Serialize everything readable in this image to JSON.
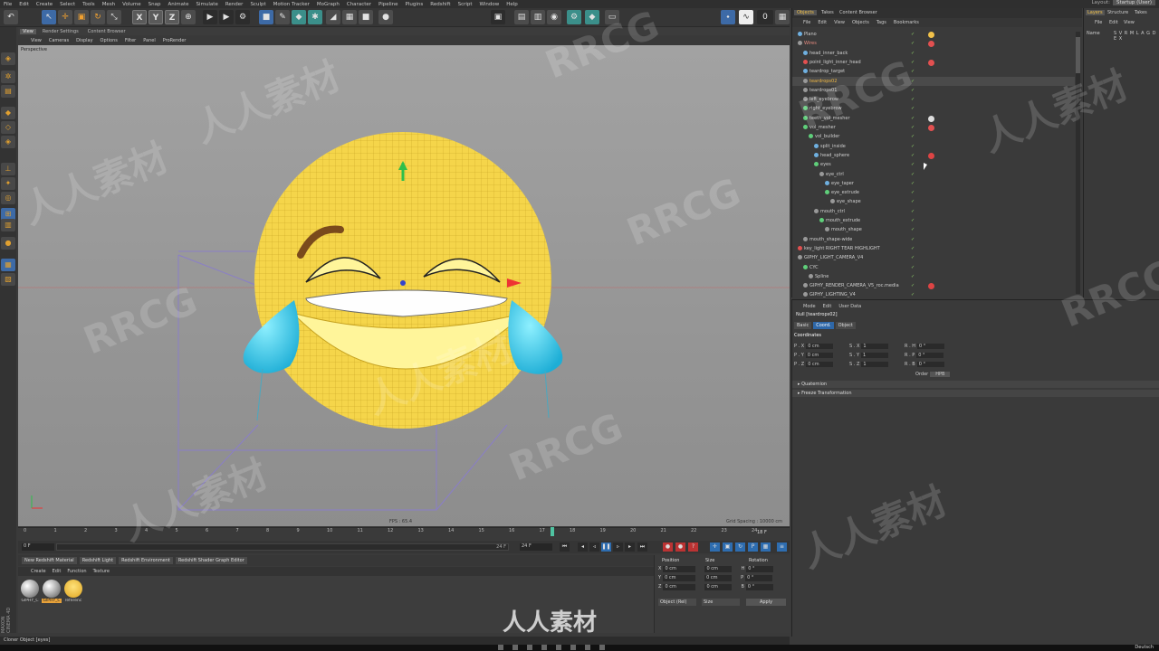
{
  "menubar": {
    "items": [
      "File",
      "Edit",
      "Create",
      "Select",
      "Tools",
      "Mesh",
      "Volume",
      "Snap",
      "Animate",
      "Simulate",
      "Render",
      "Sculpt",
      "Motion Tracker",
      "MoGraph",
      "Character",
      "Pipeline",
      "Plugins",
      "Redshift",
      "Script",
      "Window",
      "Help"
    ],
    "layout_label": "Layout:",
    "layout_value": "Startup (User)"
  },
  "toolbar": {
    "axis_x": "X",
    "axis_y": "Y",
    "axis_z": "Z",
    "frame_value": "0"
  },
  "viewport": {
    "tabs": [
      "View",
      "Render Settings",
      "Content Browser"
    ],
    "menu": [
      "View",
      "Cameras",
      "Display",
      "Options",
      "Filter",
      "Panel",
      "ProRender"
    ],
    "camera_label": "Perspective",
    "fps_text": "FPS : 65.4",
    "grid_spacing": "Grid Spacing : 10000 cm"
  },
  "timeline": {
    "ticks": [
      "0",
      "1",
      "2",
      "3",
      "4",
      "5",
      "6",
      "7",
      "8",
      "9",
      "10",
      "11",
      "12",
      "13",
      "14",
      "15",
      "16",
      "17",
      "18",
      "19",
      "20",
      "21",
      "22",
      "23",
      "24"
    ],
    "current_frame_label": "18 F",
    "start_frame": "0 F",
    "end_frame": "24 F",
    "range_end": "24 F"
  },
  "render_tabs": [
    "New Redshift Material",
    "Redshift Light",
    "Redshift Environment",
    "Redshift Shader Graph Editor"
  ],
  "material_menu": [
    "Create",
    "Edit",
    "Function",
    "Texture"
  ],
  "materials": [
    {
      "label": "GIPHY_C",
      "selected": false
    },
    {
      "label": "GIPHY_C",
      "selected": true
    },
    {
      "label": "referenc",
      "selected": false
    }
  ],
  "coord_manager": {
    "headers": [
      "Position",
      "Size",
      "Rotation"
    ],
    "rows": [
      {
        "axis": "X",
        "pos": "0 cm",
        "size": "0 cm",
        "rot_label": "H",
        "rot": "0 °"
      },
      {
        "axis": "Y",
        "pos": "0 cm",
        "size": "0 cm",
        "rot_label": "P",
        "rot": "0 °"
      },
      {
        "axis": "Z",
        "pos": "0 cm",
        "size": "0 cm",
        "rot_label": "B",
        "rot": "0 °"
      }
    ],
    "mode_dropdown": "Object (Rel)",
    "size_dropdown": "Size",
    "apply_label": "Apply"
  },
  "status": "Cloner Object [eyes]",
  "taskbar": {
    "time": "Deutsch"
  },
  "object_manager": {
    "tabs": [
      "Objects",
      "Takes",
      "Content Browser"
    ],
    "menu": [
      "File",
      "Edit",
      "View",
      "Objects",
      "Tags",
      "Bookmarks"
    ],
    "rows": [
      {
        "name": "Plano",
        "indent": 0,
        "icon": "b",
        "style": ""
      },
      {
        "name": "Wires",
        "indent": 0,
        "icon": "w",
        "style": "pk"
      },
      {
        "name": "head_inner_back",
        "indent": 1,
        "icon": "b",
        "style": ""
      },
      {
        "name": "point_light_inner_head",
        "indent": 1,
        "icon": "r",
        "style": ""
      },
      {
        "name": "teardrop_target",
        "indent": 1,
        "icon": "b",
        "style": ""
      },
      {
        "name": "teardrops02",
        "indent": 1,
        "icon": "w",
        "style": "hl"
      },
      {
        "name": "teardrops01",
        "indent": 1,
        "icon": "w",
        "style": ""
      },
      {
        "name": "left_eyebrow",
        "indent": 1,
        "icon": "w",
        "style": ""
      },
      {
        "name": "right_eyebrow",
        "indent": 1,
        "icon": "g",
        "style": ""
      },
      {
        "name": "teeth_vol_mesher",
        "indent": 1,
        "icon": "g",
        "style": ""
      },
      {
        "name": "vol_mesher",
        "indent": 1,
        "icon": "g",
        "style": ""
      },
      {
        "name": "vol_builder",
        "indent": 2,
        "icon": "g",
        "style": ""
      },
      {
        "name": "split_inside",
        "indent": 3,
        "icon": "b",
        "style": ""
      },
      {
        "name": "head_sphere",
        "indent": 3,
        "icon": "b",
        "style": ""
      },
      {
        "name": "eyes",
        "indent": 3,
        "icon": "g",
        "style": ""
      },
      {
        "name": "eye_ctrl",
        "indent": 4,
        "icon": "w",
        "style": ""
      },
      {
        "name": "eye_taper",
        "indent": 5,
        "icon": "b",
        "style": ""
      },
      {
        "name": "eye_extrude",
        "indent": 5,
        "icon": "g",
        "style": ""
      },
      {
        "name": "eye_shape",
        "indent": 6,
        "icon": "w",
        "style": ""
      },
      {
        "name": "mouth_ctrl",
        "indent": 3,
        "icon": "w",
        "style": ""
      },
      {
        "name": "mouth_extrude",
        "indent": 4,
        "icon": "g",
        "style": ""
      },
      {
        "name": "mouth_shape",
        "indent": 5,
        "icon": "w",
        "style": ""
      },
      {
        "name": "mouth_shape-wide",
        "indent": 1,
        "icon": "w",
        "style": ""
      },
      {
        "name": "key_light RIGHT TEAR HIGHLIGHT",
        "indent": 0,
        "icon": "r",
        "style": ""
      },
      {
        "name": "GIPHY_LIGHT_CAMERA_V4",
        "indent": 0,
        "icon": "w",
        "style": ""
      },
      {
        "name": "CYC",
        "indent": 1,
        "icon": "g",
        "style": ""
      },
      {
        "name": "Spline",
        "indent": 2,
        "icon": "w",
        "style": ""
      },
      {
        "name": "GIPHY_RENDER_CAMERA_V5_roc.media",
        "indent": 1,
        "icon": "w",
        "style": ""
      },
      {
        "name": "GIPHY_LIGHTING_V4",
        "indent": 1,
        "icon": "w",
        "style": ""
      }
    ]
  },
  "layers_panel": {
    "tabs": [
      "Layers",
      "Structure",
      "Takes"
    ],
    "menu": [
      "File",
      "Edit",
      "View"
    ],
    "header_name": "Name",
    "header_flags": "S V R M L A G D E X"
  },
  "attributes": {
    "menu": [
      "Mode",
      "Edit",
      "User Data"
    ],
    "title": "Null [teardrops02]",
    "tabs": [
      "Basic",
      "Coord.",
      "Object"
    ],
    "section": "Coordinates",
    "rows": [
      {
        "p": "P . X",
        "pv": "0 cm",
        "s": "S . X",
        "sv": "1",
        "r": "R . H",
        "rv": "0 °"
      },
      {
        "p": "P . Y",
        "pv": "0 cm",
        "s": "S . Y",
        "sv": "1",
        "r": "R . P",
        "rv": "0 °"
      },
      {
        "p": "P . Z",
        "pv": "0 cm",
        "s": "S . Z",
        "sv": "1",
        "r": "R . B",
        "rv": "0 °"
      }
    ],
    "order_label": "Order",
    "order_value": "HPB",
    "folds": [
      "Quaternion",
      "Freeze Transformation"
    ]
  },
  "watermarks": [
    "RRCG",
    "人人素材",
    "RRCG",
    "人人素材",
    "RRCG",
    "人人素材",
    "RRCG",
    "人人素材",
    "RRCG",
    "人人素材",
    "RRCG",
    "人人素材"
  ],
  "bottom_logo": "人人素材",
  "colors": {
    "accent_blue": "#2e67a8",
    "selection_orange": "#f0b843",
    "face_yellow": "#f5d54a",
    "tear_cyan": "#3cc6e8"
  }
}
